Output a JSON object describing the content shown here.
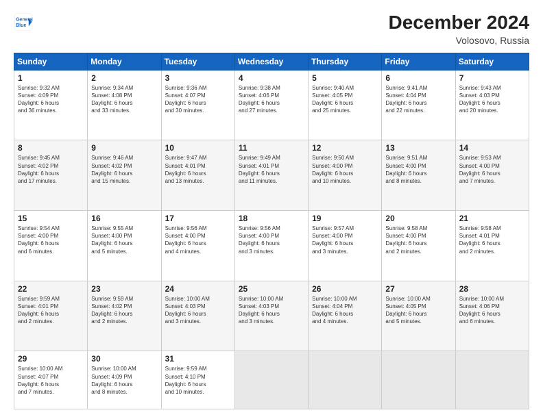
{
  "header": {
    "logo_line1": "General",
    "logo_line2": "Blue",
    "title": "December 2024",
    "subtitle": "Volosovo, Russia"
  },
  "columns": [
    "Sunday",
    "Monday",
    "Tuesday",
    "Wednesday",
    "Thursday",
    "Friday",
    "Saturday"
  ],
  "weeks": [
    [
      {
        "day": "1",
        "lines": [
          "Sunrise: 9:32 AM",
          "Sunset: 4:09 PM",
          "Daylight: 6 hours",
          "and 36 minutes."
        ]
      },
      {
        "day": "2",
        "lines": [
          "Sunrise: 9:34 AM",
          "Sunset: 4:08 PM",
          "Daylight: 6 hours",
          "and 33 minutes."
        ]
      },
      {
        "day": "3",
        "lines": [
          "Sunrise: 9:36 AM",
          "Sunset: 4:07 PM",
          "Daylight: 6 hours",
          "and 30 minutes."
        ]
      },
      {
        "day": "4",
        "lines": [
          "Sunrise: 9:38 AM",
          "Sunset: 4:06 PM",
          "Daylight: 6 hours",
          "and 27 minutes."
        ]
      },
      {
        "day": "5",
        "lines": [
          "Sunrise: 9:40 AM",
          "Sunset: 4:05 PM",
          "Daylight: 6 hours",
          "and 25 minutes."
        ]
      },
      {
        "day": "6",
        "lines": [
          "Sunrise: 9:41 AM",
          "Sunset: 4:04 PM",
          "Daylight: 6 hours",
          "and 22 minutes."
        ]
      },
      {
        "day": "7",
        "lines": [
          "Sunrise: 9:43 AM",
          "Sunset: 4:03 PM",
          "Daylight: 6 hours",
          "and 20 minutes."
        ]
      }
    ],
    [
      {
        "day": "8",
        "lines": [
          "Sunrise: 9:45 AM",
          "Sunset: 4:02 PM",
          "Daylight: 6 hours",
          "and 17 minutes."
        ]
      },
      {
        "day": "9",
        "lines": [
          "Sunrise: 9:46 AM",
          "Sunset: 4:02 PM",
          "Daylight: 6 hours",
          "and 15 minutes."
        ]
      },
      {
        "day": "10",
        "lines": [
          "Sunrise: 9:47 AM",
          "Sunset: 4:01 PM",
          "Daylight: 6 hours",
          "and 13 minutes."
        ]
      },
      {
        "day": "11",
        "lines": [
          "Sunrise: 9:49 AM",
          "Sunset: 4:01 PM",
          "Daylight: 6 hours",
          "and 11 minutes."
        ]
      },
      {
        "day": "12",
        "lines": [
          "Sunrise: 9:50 AM",
          "Sunset: 4:00 PM",
          "Daylight: 6 hours",
          "and 10 minutes."
        ]
      },
      {
        "day": "13",
        "lines": [
          "Sunrise: 9:51 AM",
          "Sunset: 4:00 PM",
          "Daylight: 6 hours",
          "and 8 minutes."
        ]
      },
      {
        "day": "14",
        "lines": [
          "Sunrise: 9:53 AM",
          "Sunset: 4:00 PM",
          "Daylight: 6 hours",
          "and 7 minutes."
        ]
      }
    ],
    [
      {
        "day": "15",
        "lines": [
          "Sunrise: 9:54 AM",
          "Sunset: 4:00 PM",
          "Daylight: 6 hours",
          "and 6 minutes."
        ]
      },
      {
        "day": "16",
        "lines": [
          "Sunrise: 9:55 AM",
          "Sunset: 4:00 PM",
          "Daylight: 6 hours",
          "and 5 minutes."
        ]
      },
      {
        "day": "17",
        "lines": [
          "Sunrise: 9:56 AM",
          "Sunset: 4:00 PM",
          "Daylight: 6 hours",
          "and 4 minutes."
        ]
      },
      {
        "day": "18",
        "lines": [
          "Sunrise: 9:56 AM",
          "Sunset: 4:00 PM",
          "Daylight: 6 hours",
          "and 3 minutes."
        ]
      },
      {
        "day": "19",
        "lines": [
          "Sunrise: 9:57 AM",
          "Sunset: 4:00 PM",
          "Daylight: 6 hours",
          "and 3 minutes."
        ]
      },
      {
        "day": "20",
        "lines": [
          "Sunrise: 9:58 AM",
          "Sunset: 4:00 PM",
          "Daylight: 6 hours",
          "and 2 minutes."
        ]
      },
      {
        "day": "21",
        "lines": [
          "Sunrise: 9:58 AM",
          "Sunset: 4:01 PM",
          "Daylight: 6 hours",
          "and 2 minutes."
        ]
      }
    ],
    [
      {
        "day": "22",
        "lines": [
          "Sunrise: 9:59 AM",
          "Sunset: 4:01 PM",
          "Daylight: 6 hours",
          "and 2 minutes."
        ]
      },
      {
        "day": "23",
        "lines": [
          "Sunrise: 9:59 AM",
          "Sunset: 4:02 PM",
          "Daylight: 6 hours",
          "and 2 minutes."
        ]
      },
      {
        "day": "24",
        "lines": [
          "Sunrise: 10:00 AM",
          "Sunset: 4:03 PM",
          "Daylight: 6 hours",
          "and 3 minutes."
        ]
      },
      {
        "day": "25",
        "lines": [
          "Sunrise: 10:00 AM",
          "Sunset: 4:03 PM",
          "Daylight: 6 hours",
          "and 3 minutes."
        ]
      },
      {
        "day": "26",
        "lines": [
          "Sunrise: 10:00 AM",
          "Sunset: 4:04 PM",
          "Daylight: 6 hours",
          "and 4 minutes."
        ]
      },
      {
        "day": "27",
        "lines": [
          "Sunrise: 10:00 AM",
          "Sunset: 4:05 PM",
          "Daylight: 6 hours",
          "and 5 minutes."
        ]
      },
      {
        "day": "28",
        "lines": [
          "Sunrise: 10:00 AM",
          "Sunset: 4:06 PM",
          "Daylight: 6 hours",
          "and 6 minutes."
        ]
      }
    ],
    [
      {
        "day": "29",
        "lines": [
          "Sunrise: 10:00 AM",
          "Sunset: 4:07 PM",
          "Daylight: 6 hours",
          "and 7 minutes."
        ]
      },
      {
        "day": "30",
        "lines": [
          "Sunrise: 10:00 AM",
          "Sunset: 4:09 PM",
          "Daylight: 6 hours",
          "and 8 minutes."
        ]
      },
      {
        "day": "31",
        "lines": [
          "Sunrise: 9:59 AM",
          "Sunset: 4:10 PM",
          "Daylight: 6 hours",
          "and 10 minutes."
        ]
      },
      null,
      null,
      null,
      null
    ]
  ]
}
